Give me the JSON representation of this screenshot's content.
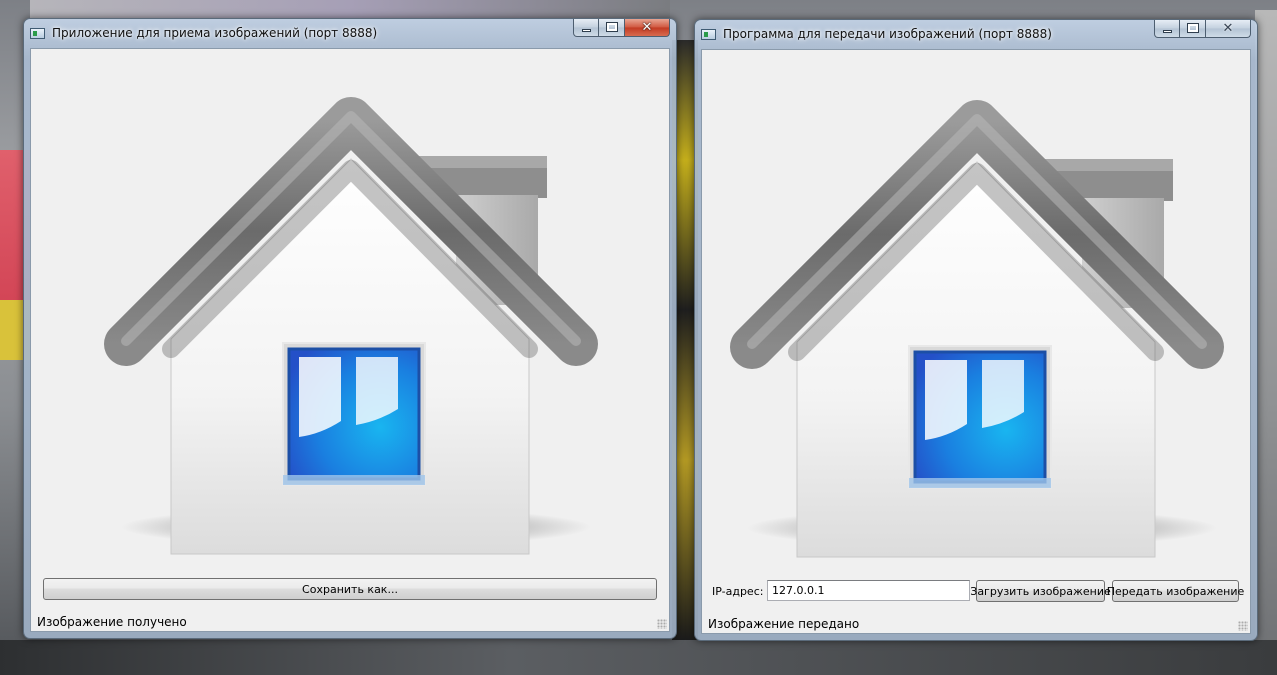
{
  "receiver_window": {
    "title": "Приложение для приема изображений (порт 8888)",
    "save_button_label": "Сохранить как...",
    "status": "Изображение получено",
    "image_icon": "home-icon"
  },
  "sender_window": {
    "title": "Программа для передачи изображений (порт 8888)",
    "ip_label": "IP-адрес:",
    "ip_value": "127.0.0.1",
    "load_button_label": "Загрузить изображение",
    "send_button_label": "Передать изображение",
    "status": "Изображение передано",
    "image_icon": "home-icon"
  },
  "window_controls": {
    "close_glyph": "✕"
  },
  "colors": {
    "window_glass": "#b4c6dc",
    "client_bg": "#f0f0f0",
    "close_active": "#c23a22",
    "house_window_blue": "#1a7fe0"
  }
}
